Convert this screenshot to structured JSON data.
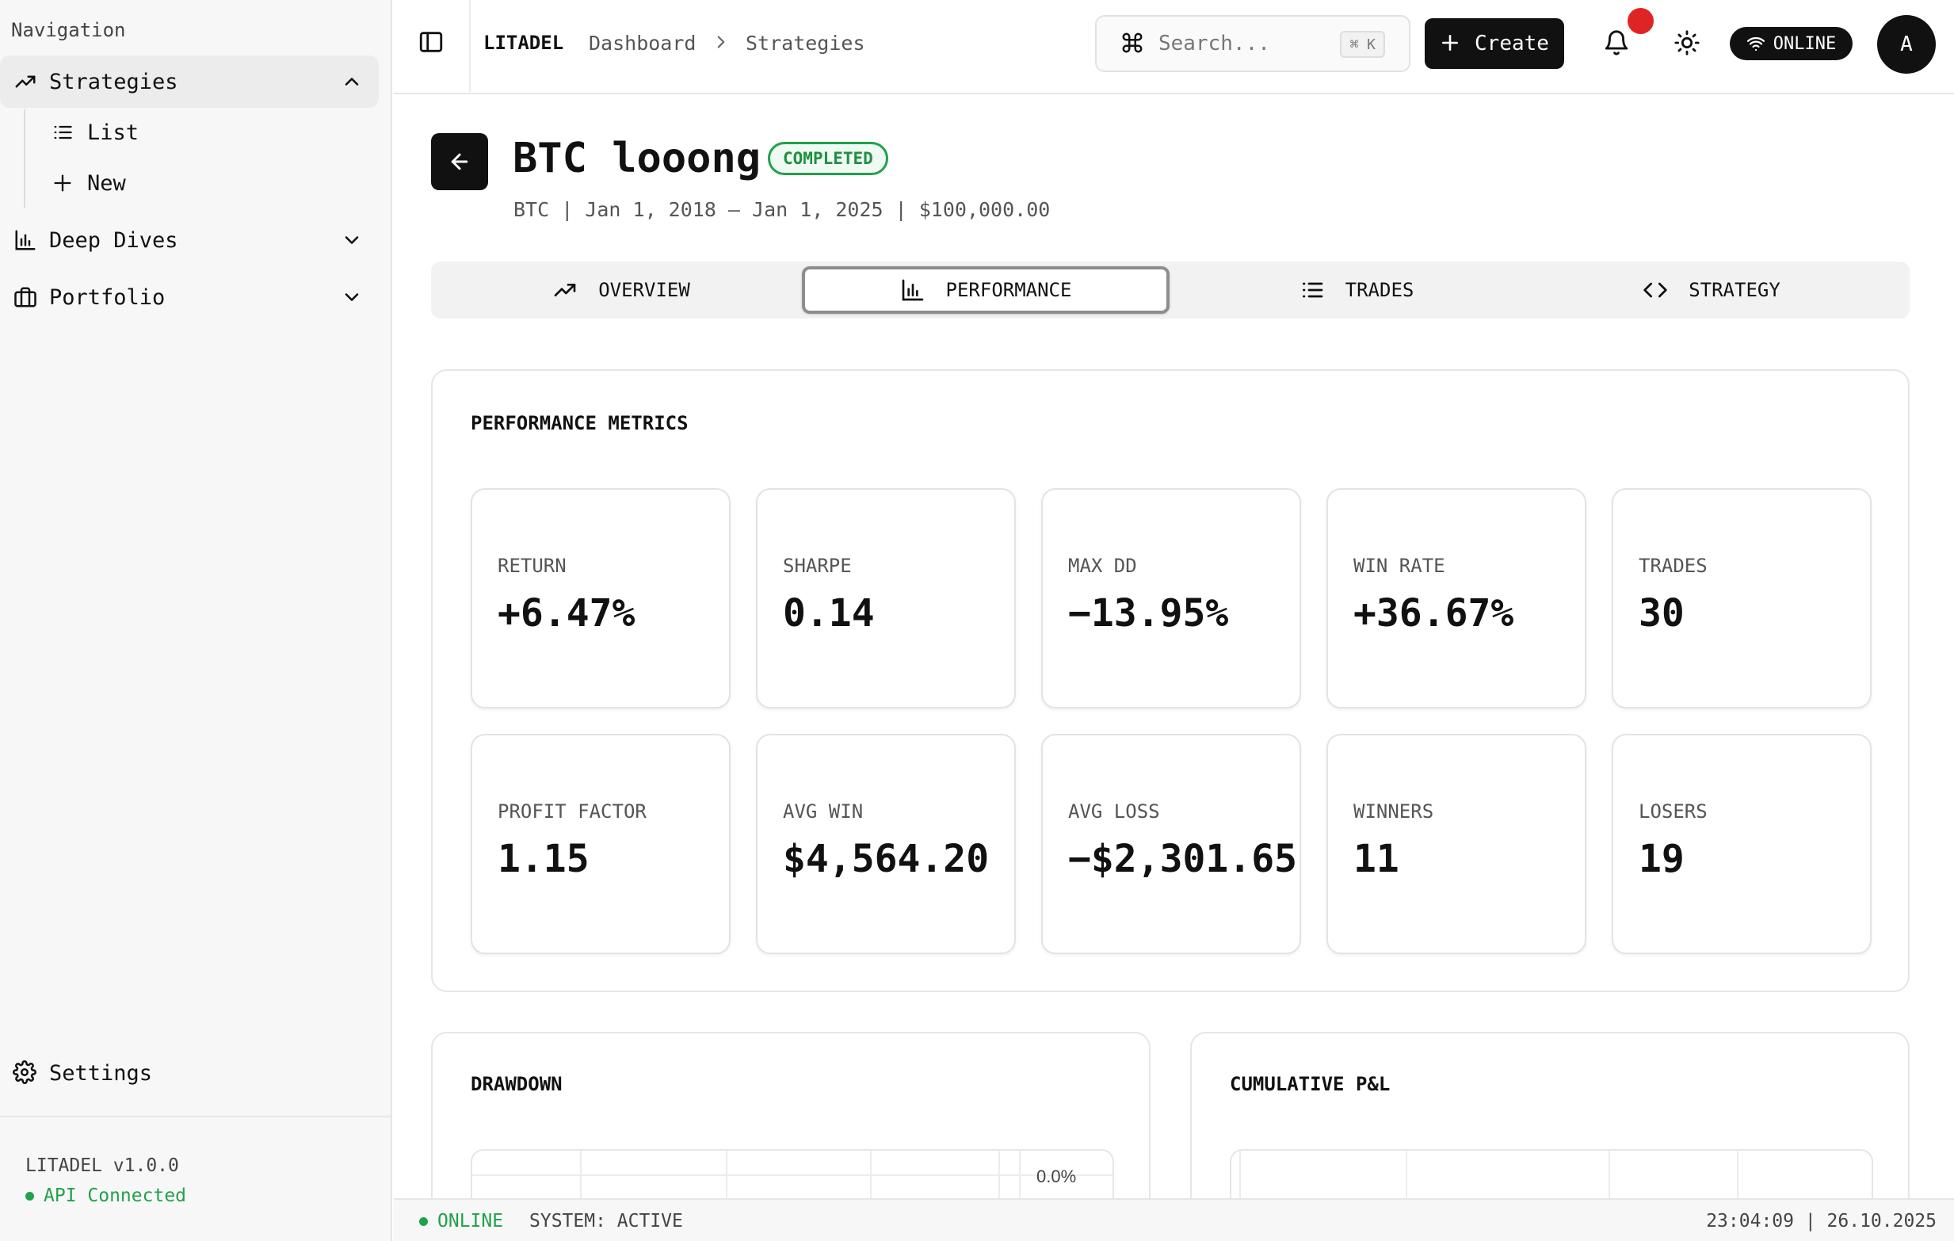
{
  "sidebar": {
    "heading": "Navigation",
    "strategies": {
      "label": "Strategies",
      "items": [
        {
          "label": "List"
        },
        {
          "label": "New"
        }
      ]
    },
    "deep_dives": {
      "label": "Deep Dives"
    },
    "portfolio": {
      "label": "Portfolio"
    },
    "settings": {
      "label": "Settings"
    },
    "version": "LITADEL v1.0.0",
    "api_status": "API Connected"
  },
  "topbar": {
    "brand": "LITADEL",
    "breadcrumb": [
      "Dashboard",
      "Strategies"
    ],
    "search_placeholder": "Search...",
    "search_shortcut": "⌘ K",
    "create_label": "Create",
    "connection_status": "ONLINE",
    "avatar_initial": "A"
  },
  "strategy": {
    "title": "BTC looong",
    "status": "COMPLETED",
    "subtitle": "BTC | Jan 1, 2018 – Jan 1, 2025 | $100,000.00"
  },
  "tabs": [
    {
      "label": "OVERVIEW",
      "active": false
    },
    {
      "label": "PERFORMANCE",
      "active": true
    },
    {
      "label": "TRADES",
      "active": false
    },
    {
      "label": "STRATEGY",
      "active": false
    }
  ],
  "metrics": {
    "title": "PERFORMANCE METRICS",
    "items": [
      {
        "label": "RETURN",
        "value": "+6.47%"
      },
      {
        "label": "SHARPE",
        "value": "0.14"
      },
      {
        "label": "MAX DD",
        "value": "−13.95%"
      },
      {
        "label": "WIN RATE",
        "value": "+36.67%"
      },
      {
        "label": "TRADES",
        "value": "30"
      },
      {
        "label": "PROFIT FACTOR",
        "value": "1.15"
      },
      {
        "label": "AVG WIN",
        "value": "$4,564.20"
      },
      {
        "label": "AVG LOSS",
        "value": "−$2,301.65"
      },
      {
        "label": "WINNERS",
        "value": "11"
      },
      {
        "label": "LOSERS",
        "value": "19"
      }
    ]
  },
  "drawdown": {
    "title": "DRAWDOWN",
    "y_tick": "0.0%"
  },
  "cumulative_pnl": {
    "title": "CUMULATIVE P&L"
  },
  "statusbar": {
    "online": "ONLINE",
    "system": "SYSTEM: ACTIVE",
    "clock": "23:04:09 | 26.10.2025"
  },
  "colors": {
    "accent": "#111111",
    "success": "#22a04b",
    "notification": "#e02424"
  }
}
